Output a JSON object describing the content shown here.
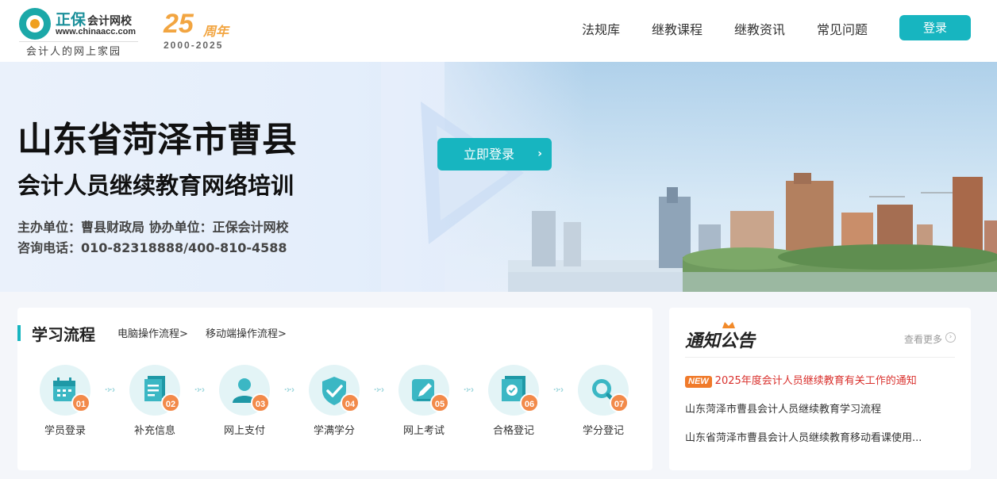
{
  "header": {
    "logo_brand": "正保",
    "logo_brand_sub": "会计网校",
    "logo_url": "www.chinaacc.com",
    "logo_slogan": "会计人的网上家园",
    "anniversary_number": "25",
    "anniversary_label": "周年",
    "anniversary_years": "2000-2025",
    "nav": [
      "法规库",
      "继教课程",
      "继教资讯",
      "常见问题"
    ],
    "login_label": "登录",
    "accent_color": "#17b5c0"
  },
  "banner": {
    "title": "山东省菏泽市曹县",
    "subtitle": "会计人员继续教育网络培训",
    "organizer": "主办单位：曹县财政局    协办单位：正保会计网校",
    "hotline": "咨询电话：010-82318888/400-810-4588",
    "login_now_label": "立即登录",
    "login_now_arrow": "›"
  },
  "process": {
    "title": "学习流程",
    "links": [
      "电脑操作流程>",
      "移动端操作流程>"
    ],
    "steps": [
      {
        "num": "01",
        "label": "学员登录",
        "icon": "calendar-icon"
      },
      {
        "num": "02",
        "label": "补充信息",
        "icon": "document-icon"
      },
      {
        "num": "03",
        "label": "网上支付",
        "icon": "user-icon"
      },
      {
        "num": "04",
        "label": "学满学分",
        "icon": "shield-check-icon"
      },
      {
        "num": "05",
        "label": "网上考试",
        "icon": "edit-icon"
      },
      {
        "num": "06",
        "label": "合格登记",
        "icon": "certificate-icon"
      },
      {
        "num": "07",
        "label": "学分登记",
        "icon": "search-icon"
      }
    ],
    "arrow_text": "·›·›"
  },
  "notice": {
    "title": "通知公告",
    "more_label": "查看更多",
    "more_icon": "›",
    "new_badge": "NEW",
    "items": [
      "2025年度会计人员继续教育有关工作的通知",
      "山东菏泽市曹县会计人员继续教育学习流程",
      "山东省菏泽市曹县会计人员继续教育移动看课使用..."
    ],
    "hot_color": "#d9302c"
  }
}
